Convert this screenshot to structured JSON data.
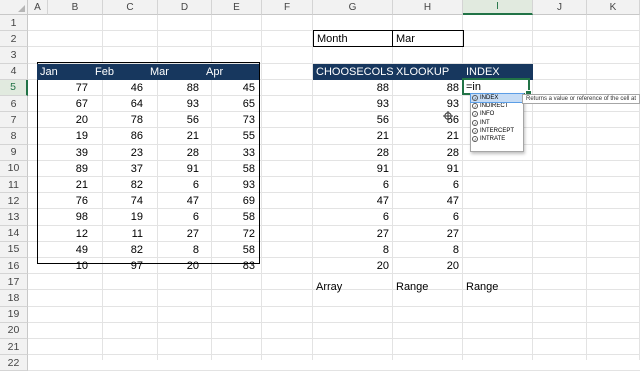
{
  "columns": [
    "A",
    "B",
    "C",
    "D",
    "E",
    "F",
    "G",
    "H",
    "I",
    "J",
    "K"
  ],
  "selected_column": "I",
  "rows": [
    1,
    2,
    3,
    4,
    5,
    6,
    7,
    8,
    9,
    10,
    11,
    12,
    13,
    14,
    15,
    16,
    17,
    18,
    19,
    20,
    21,
    22
  ],
  "selected_row": 5,
  "month_label": "Month",
  "month_value": "Mar",
  "table_headers": [
    "Jan",
    "Feb",
    "Mar",
    "Apr"
  ],
  "table_rows": [
    [
      77,
      46,
      88,
      45
    ],
    [
      67,
      64,
      93,
      65
    ],
    [
      20,
      78,
      56,
      73
    ],
    [
      19,
      86,
      21,
      55
    ],
    [
      39,
      23,
      28,
      33
    ],
    [
      89,
      37,
      91,
      58
    ],
    [
      21,
      82,
      6,
      93
    ],
    [
      76,
      74,
      47,
      69
    ],
    [
      98,
      19,
      6,
      58
    ],
    [
      12,
      11,
      27,
      72
    ],
    [
      49,
      82,
      8,
      58
    ],
    [
      10,
      97,
      20,
      83
    ]
  ],
  "result_headers": [
    "CHOOSECOLS",
    "XLOOKUP",
    "INDEX"
  ],
  "choosecols_values": [
    88,
    93,
    56,
    21,
    28,
    91,
    6,
    47,
    6,
    27,
    8,
    20
  ],
  "xlookup_values": [
    88,
    93,
    56,
    21,
    28,
    91,
    6,
    47,
    6,
    27,
    8,
    20
  ],
  "formula_text": "=in",
  "autocomplete": [
    "INDEX",
    "INDIRECT",
    "INFO",
    "INT",
    "INTERCEPT",
    "INTRATE"
  ],
  "autocomplete_selected": 0,
  "tooltip": "Returns a value or reference of the cell at",
  "row18_labels": [
    "Array",
    "Range",
    "Range"
  ],
  "colors": {
    "table_header": "#17375e",
    "selection": "#217346"
  }
}
